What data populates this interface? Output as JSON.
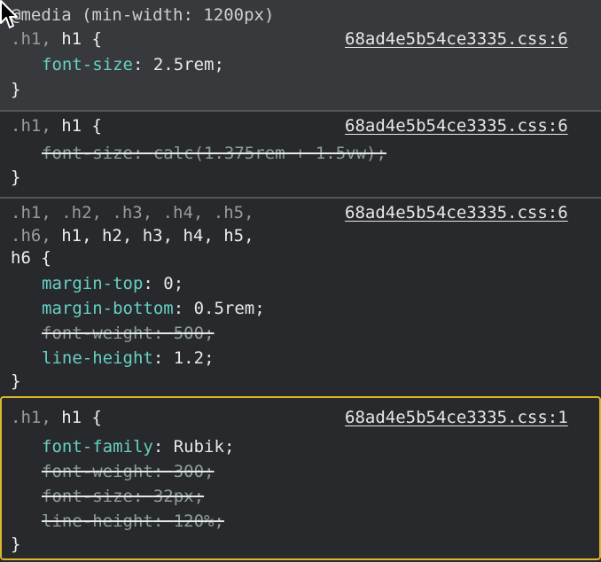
{
  "media_query": "@media (min-width: 1200px)",
  "rules": [
    {
      "selector_dim_1": ".h1, ",
      "selector_match_1": "h1",
      "open": " {",
      "source": "68ad4e5b54ce3335.css:6",
      "declarations": [
        {
          "prop": "font-size",
          "value": "2.5rem",
          "struck": false
        }
      ],
      "close": "}"
    },
    {
      "selector_dim_1": ".h1, ",
      "selector_match_1": "h1",
      "open": " {",
      "source": "68ad4e5b54ce3335.css:6",
      "declarations": [
        {
          "prop": "font-size",
          "value": "calc(1.375rem + 1.5vw)",
          "struck": true
        }
      ],
      "close": "}"
    },
    {
      "selector_line_1_dim": ".h1, .h2, .h3, .h4, .h5,",
      "selector_line_2_dim": ".h6, ",
      "selector_line_2_match": "h1, h2, h3, h4, h5,",
      "selector_line_3_match": "h6",
      "open": " {",
      "source": "68ad4e5b54ce3335.css:6",
      "declarations": [
        {
          "prop": "margin-top",
          "value": "0",
          "struck": false
        },
        {
          "prop": "margin-bottom",
          "value": "0.5rem",
          "struck": false
        },
        {
          "prop": "font-weight",
          "value": "500",
          "struck": true
        },
        {
          "prop": "line-height",
          "value": "1.2",
          "struck": false
        }
      ],
      "close": "}"
    },
    {
      "selector_dim_1": ".h1, ",
      "selector_match_1": "h1",
      "open": " {",
      "source": "68ad4e5b54ce3335.css:1",
      "declarations": [
        {
          "prop": "font-family",
          "value": "Rubik",
          "struck": false
        },
        {
          "prop": "font-weight",
          "value": "300",
          "struck": true
        },
        {
          "prop": "font-size",
          "value": "32px",
          "struck": true
        },
        {
          "prop": "line-height",
          "value": "120%",
          "struck": true
        }
      ],
      "close": "}"
    }
  ],
  "colors": {
    "background": "#28292c",
    "media_background": "#38393c",
    "property": "#67d0c2",
    "selection_border": "#d9b92b"
  }
}
